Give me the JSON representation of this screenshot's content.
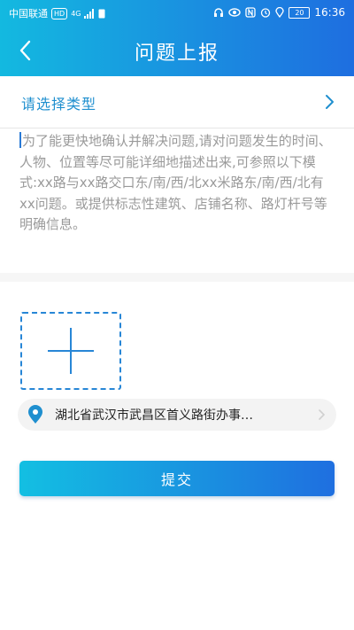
{
  "status_bar": {
    "carrier": "中国联通",
    "hd": "HD",
    "network": "4G",
    "battery": "20",
    "time": "16:36"
  },
  "header": {
    "title": "问题上报",
    "back_icon": "chevron-left-icon"
  },
  "type_selector": {
    "label": "请选择类型",
    "arrow_icon": "chevron-right-icon"
  },
  "description": {
    "placeholder": "为了能更快地确认并解决问题,请对问题发生的时间、人物、位置等尽可能详细地描述出来,可参照以下模式:xx路与xx路交口东/南/西/北xx米路东/南/西/北有xx问题。或提供标志性建筑、店铺名称、路灯杆号等明确信息。"
  },
  "upload": {
    "icon": "plus-icon"
  },
  "location": {
    "icon": "map-pin-icon",
    "text": "湖北省武汉市武昌区首义路街办事…"
  },
  "submit": {
    "label": "提交"
  },
  "colors": {
    "accent": "#1f8fcf",
    "header_start": "#13b9e0",
    "header_end": "#1e6ee0"
  }
}
